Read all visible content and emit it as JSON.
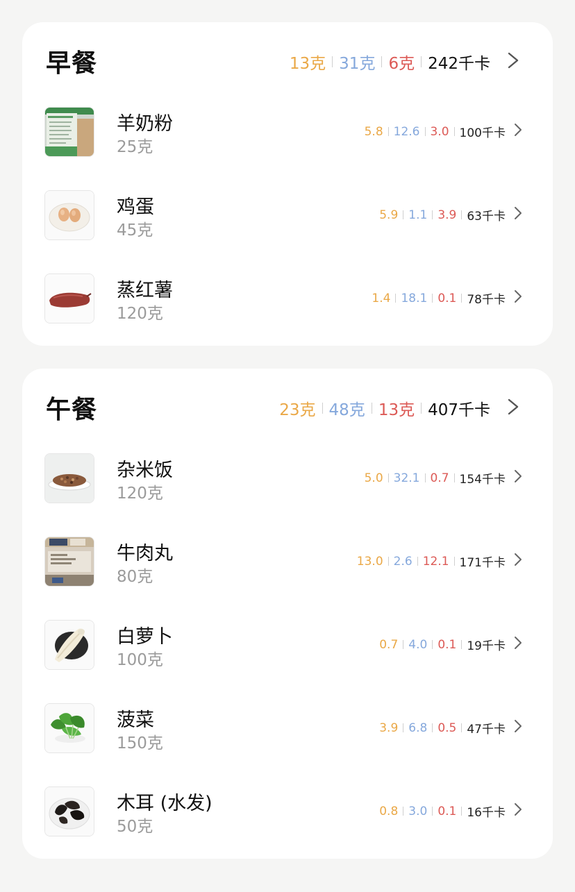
{
  "unit_gram": "克",
  "unit_kcal": "千卡",
  "meals": [
    {
      "title": "早餐",
      "carb": "13克",
      "protein": "31克",
      "fat": "6克",
      "kcal": "242千卡",
      "foods": [
        {
          "name": "羊奶粉",
          "qty": "25克",
          "carb": "5.8",
          "protein": "12.6",
          "fat": "3.0",
          "kcal": "100千卡",
          "icon": "goat-milk-powder"
        },
        {
          "name": "鸡蛋",
          "qty": "45克",
          "carb": "5.9",
          "protein": "1.1",
          "fat": "3.9",
          "kcal": "63千卡",
          "icon": "eggs"
        },
        {
          "name": "蒸红薯",
          "qty": "120克",
          "carb": "1.4",
          "protein": "18.1",
          "fat": "0.1",
          "kcal": "78千卡",
          "icon": "sweet-potato"
        }
      ]
    },
    {
      "title": "午餐",
      "carb": "23克",
      "protein": "48克",
      "fat": "13克",
      "kcal": "407千卡",
      "foods": [
        {
          "name": "杂米饭",
          "qty": "120克",
          "carb": "5.0",
          "protein": "32.1",
          "fat": "0.7",
          "kcal": "154千卡",
          "icon": "mixed-rice"
        },
        {
          "name": "牛肉丸",
          "qty": "80克",
          "carb": "13.0",
          "protein": "2.6",
          "fat": "12.1",
          "kcal": "171千卡",
          "icon": "beef-balls"
        },
        {
          "name": "白萝卜",
          "qty": "100克",
          "carb": "0.7",
          "protein": "4.0",
          "fat": "0.1",
          "kcal": "19千卡",
          "icon": "white-radish"
        },
        {
          "name": "菠菜",
          "qty": "150克",
          "carb": "3.9",
          "protein": "6.8",
          "fat": "0.5",
          "kcal": "47千卡",
          "icon": "spinach"
        },
        {
          "name": "木耳 (水发)",
          "qty": "50克",
          "carb": "0.8",
          "protein": "3.0",
          "fat": "0.1",
          "kcal": "16千卡",
          "icon": "wood-ear-fungus"
        }
      ]
    }
  ],
  "colors": {
    "carb": "#eaa847",
    "protein": "#85a8dc",
    "fat": "#dc5a56",
    "background": "#f5f5f4",
    "card": "#ffffff"
  }
}
